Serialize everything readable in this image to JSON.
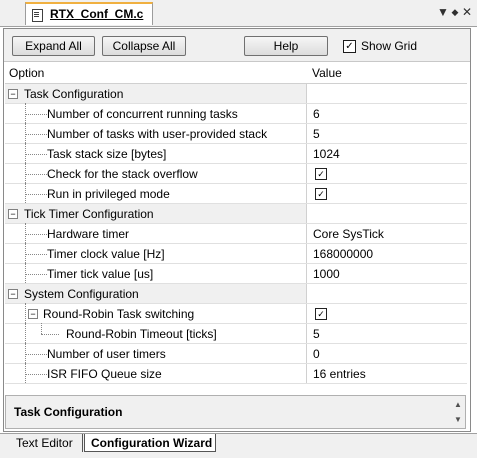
{
  "file_tab": {
    "name": "RTX_Conf_CM.c",
    "icon": "document-icon"
  },
  "window_controls": {
    "dropdown": "▼",
    "pin": "◆",
    "close": "✕"
  },
  "toolbar": {
    "expand_all": "Expand All",
    "collapse_all": "Collapse All",
    "help": "Help",
    "show_grid_label": "Show Grid",
    "show_grid_checked": true,
    "check_mark": "✓"
  },
  "grid": {
    "col_option": "Option",
    "col_value": "Value",
    "rows": [
      {
        "label": "Task Configuration",
        "value": ""
      },
      {
        "label": "Number of concurrent running tasks",
        "value": "6"
      },
      {
        "label": "Number of tasks with user-provided stack",
        "value": "5"
      },
      {
        "label": "Task stack size [bytes]",
        "value": "1024"
      },
      {
        "label": "Check for the stack overflow",
        "value": "✓"
      },
      {
        "label": "Run in privileged mode",
        "value": "✓"
      },
      {
        "label": "Tick Timer Configuration",
        "value": ""
      },
      {
        "label": "Hardware timer",
        "value": "Core SysTick"
      },
      {
        "label": "Timer clock value [Hz]",
        "value": "168000000"
      },
      {
        "label": "Timer tick value [us]",
        "value": "1000"
      },
      {
        "label": "System Configuration",
        "value": ""
      },
      {
        "label": "Round-Robin Task switching",
        "value": "✓"
      },
      {
        "label": "Round-Robin Timeout [ticks]",
        "value": "5"
      },
      {
        "label": "Number of user timers",
        "value": "0"
      },
      {
        "label": "ISR FIFO Queue size",
        "value": "16 entries"
      }
    ],
    "expander_symbol": "−"
  },
  "description": {
    "title": "Task Configuration",
    "scroll_up": "▲",
    "scroll_down": "▼"
  },
  "bottom_tabs": {
    "text_editor": "Text Editor",
    "config_wizard": "Configuration Wizard"
  },
  "colors": {
    "accent_tab": "#f0b040",
    "group_bg": "#f0f0f0"
  }
}
